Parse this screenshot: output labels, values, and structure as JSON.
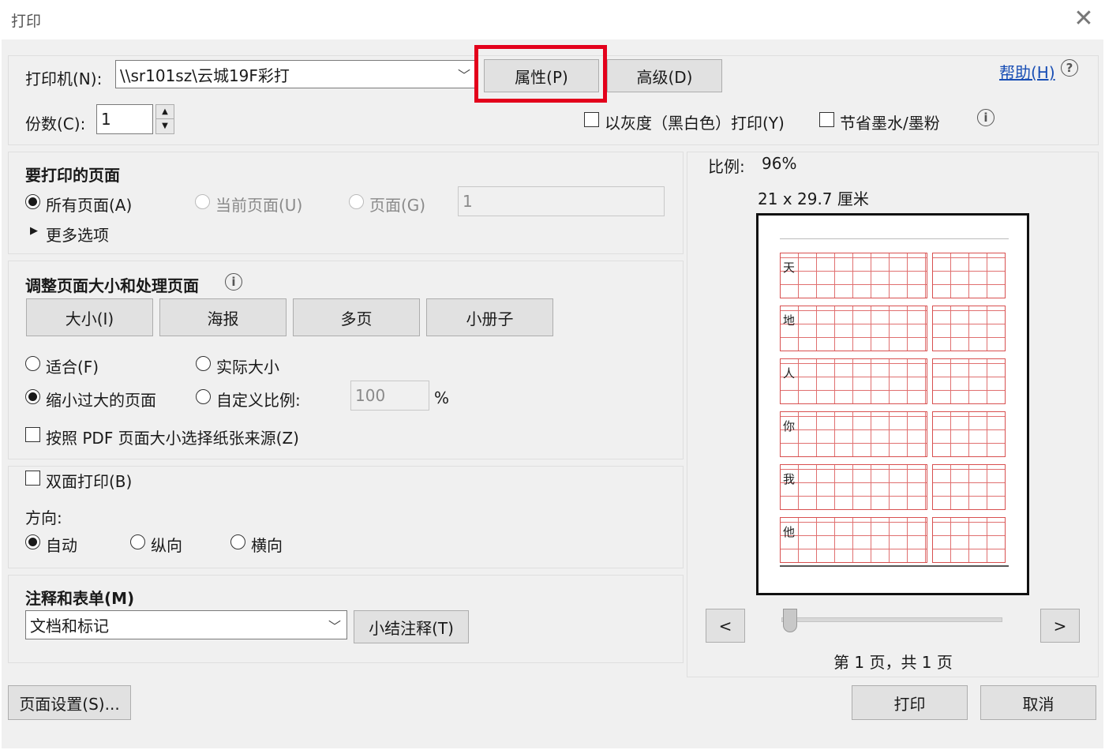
{
  "window": {
    "title": "打印",
    "close_glyph": "✕"
  },
  "printer": {
    "label": "打印机(N):",
    "value": "\\\\sr101sz\\云城19F彩打",
    "properties_button": "属性(P)",
    "advanced_button": "高级(D)",
    "help_link": "帮助(H)",
    "copies_label": "份数(C):",
    "copies_value": "1",
    "grayscale_label": "以灰度（黑白色）打印(Y)",
    "save_ink_label": "节省墨水/墨粉"
  },
  "pages": {
    "heading": "要打印的页面",
    "all_pages": "所有页面(A)",
    "current_page": "当前页面(U)",
    "page_range": "页面(G)",
    "page_range_value": "1",
    "more_options": "更多选项"
  },
  "sizing": {
    "heading": "调整页面大小和处理页面",
    "tabs": [
      "大小(I)",
      "海报",
      "多页",
      "小册子"
    ],
    "fit": "适合(F)",
    "actual_size": "实际大小",
    "shrink_oversized": "缩小过大的页面",
    "custom_scale": "自定义比例:",
    "custom_scale_value": "100",
    "percent_sign": "%",
    "paper_source": "按照 PDF 页面大小选择纸张来源(Z)"
  },
  "duplex": {
    "label": "双面打印(B)",
    "orientation_label": "方向:",
    "auto": "自动",
    "portrait": "纵向",
    "landscape": "横向"
  },
  "comments": {
    "heading": "注释和表单(M)",
    "value": "文档和标记",
    "summarize_button": "小结注释(T)"
  },
  "preview": {
    "scale_label": "比例:",
    "scale_value": "96%",
    "paper_size": "21 x 29.7 厘米",
    "prev_button": "<",
    "next_button": ">",
    "page_indicator": "第 1 页，共 1 页",
    "slider_position": 0,
    "sheet_characters": [
      "天",
      "地",
      "人",
      "你",
      "我",
      "他"
    ]
  },
  "footer": {
    "page_setup_button": "页面设置(S)...",
    "print_button": "打印",
    "cancel_button": "取消"
  },
  "colors": {
    "highlight": "#e3001b",
    "link": "#1a4fb5",
    "grid": "#d85050"
  }
}
